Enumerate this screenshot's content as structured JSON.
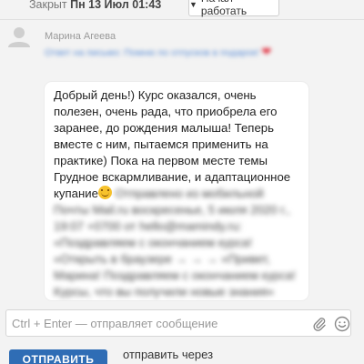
{
  "topbar": {
    "closed_prefix": "Закрыт",
    "closed_date": "Пн 13 Июл 01:43",
    "start_button_label": "Начал работать",
    "start_button_icon": "pin-icon"
  },
  "message": {
    "sender": "Марина Агеева",
    "avatar_icon": "user-avatar-icon",
    "reply_link_text": "Ответ на письмо: Помню по отпусков в подарок!",
    "text_visible": "Добрый день!) Курс оказался, очень полезен, очень рада, что приобрела его заранее, до рождения малыша! Теперь вместе с ним, пытаемся применить на практике) Пока на первом месте темы Грудное вскармливание, и адаптационное купание",
    "text_blurred": "Отправлено из мобильной Почты Mail.ru воскресенье, 5 июля 2020 г., 19:07 +0700 от hello@mamindy.ru: «Поздравляем с окончанием курса! «Открыть в браузере → → → «Привет, Марина! Поздравляем с окончанием курса! Курсы, что вы получили новые знания»"
  },
  "composer": {
    "placeholder": "Ctrl + Enter — отправляет сообщение",
    "attach_icon": "paperclip-icon",
    "emoji_icon": "emoji-smile-icon",
    "send_button_label": "ОТПРАВИТЬ",
    "send_via_label": "отправить через"
  },
  "colors": {
    "accent_blue": "#2f6db5",
    "link_blue": "#5b8dd6",
    "heart_red": "#e03040",
    "background": "#f3f3f3"
  }
}
